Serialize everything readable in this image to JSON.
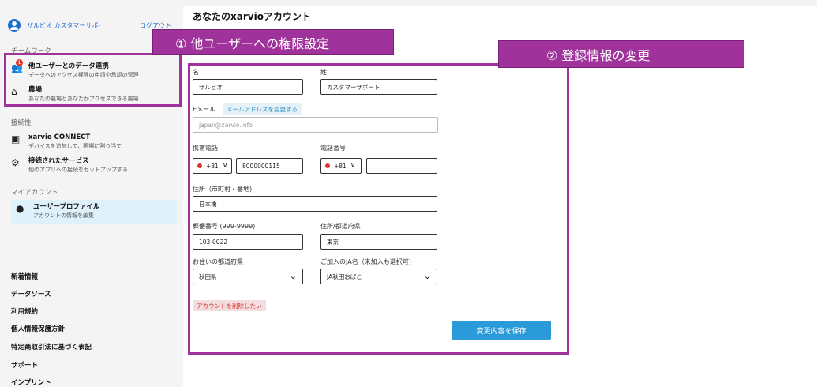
{
  "sidebar": {
    "user_name": "ザルビオ カスタマーサポ-",
    "logout": "ログアウト",
    "teamwork_label": "チームワーク",
    "teamwork_items": [
      {
        "title": "他ユーザーとのデータ連携",
        "desc": "データへのアクセス権限の申請や承認の管理",
        "badge": "1"
      },
      {
        "title": "農場",
        "desc": "あなたの農場とあなたがアクセスできる農場"
      }
    ],
    "connectivity_label": "接続性",
    "connectivity_items": [
      {
        "title": "xarvio CONNECT",
        "desc": "デバイスを追加して、圃場に割り当て"
      },
      {
        "title": "接続されたサービス",
        "desc": "他のアプリへの接続をセットアップする"
      }
    ],
    "account_label": "マイアカウント",
    "account_items": [
      {
        "title": "ユーザープロファイル",
        "desc": "アカウントの情報を編集"
      }
    ],
    "footer_links": [
      "新着情報",
      "データソース",
      "利用規約",
      "個人情報保護方針",
      "特定商取引法に基づく表記",
      "サポート",
      "インプリント"
    ]
  },
  "main": {
    "title": "あなたのxarvioアカウント",
    "annotation_1": "① 他ユーザーへの権限設定",
    "annotation_2": "② 登録情報の変更",
    "form": {
      "first_name_label": "名",
      "first_name_value": "ザルビオ",
      "last_name_label": "姓",
      "last_name_value": "カスタマーサポート",
      "email_label": "Eメール",
      "change_email": "メールアドレスを変更する",
      "email_value": "japan@xarvio.info",
      "mobile_label": "携帯電話",
      "mobile_cc": "+81",
      "mobile_value": "8000000115",
      "phone_label": "電話番号",
      "phone_cc": "+81",
      "phone_value": "",
      "address_label": "住所（市町村・番地)",
      "address_value": "日本橋",
      "postal_label": "郵便番号 (999-9999)",
      "postal_value": "103-0022",
      "pref_label": "住所/都道府県",
      "pref_value": "東京",
      "live_pref_label": "お住いの都道府県",
      "live_pref_value": "秋田県",
      "ja_label": "ご加入のJA名（未加入も選択可)",
      "ja_value": "JA秋田おばこ",
      "delete_account": "アカウントを削除したい",
      "save": "変更内容を保存"
    }
  }
}
